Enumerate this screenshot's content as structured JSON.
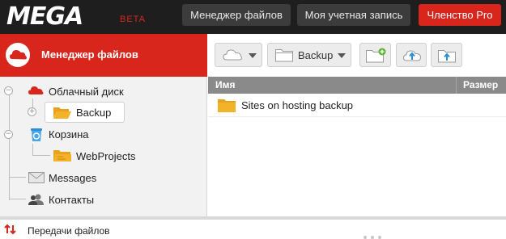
{
  "header": {
    "logo": "MEGA",
    "logo_badge": "BETA",
    "file_manager_label": "Менеджер файлов",
    "account_label": "Моя учетная запись",
    "pro_label": "Членство Pro"
  },
  "sidebar": {
    "title": "Менеджер файлов",
    "tree": [
      {
        "label": "Облачный диск",
        "icon": "cloud-icon"
      },
      {
        "label": "Backup",
        "icon": "folder-open-icon",
        "selected": true
      },
      {
        "label": "Корзина",
        "icon": "recycle-bin-icon"
      },
      {
        "label": "WebProjects",
        "icon": "folder-shared-icon"
      },
      {
        "label": "Messages",
        "icon": "envelope-icon"
      },
      {
        "label": "Контакты",
        "icon": "contacts-icon"
      }
    ]
  },
  "toolbar": {
    "breadcrumb_folder": "Backup",
    "cloud_icon": "cloud-icon",
    "new_folder_icon": "new-folder-icon",
    "upload_file_icon": "upload-icon",
    "upload_folder_icon": "upload-folder-icon"
  },
  "file_table": {
    "columns": [
      "Имя",
      "Размер"
    ],
    "rows": [
      {
        "name": "Sites on hosting backup",
        "icon": "folder-icon"
      }
    ]
  },
  "transfers": {
    "label": "Передачи файлов",
    "icon": "transfer-arrows-icon"
  },
  "colors": {
    "accent": "#d9261c",
    "topbar": "#1e1e1e",
    "folder": "#f3b229"
  }
}
